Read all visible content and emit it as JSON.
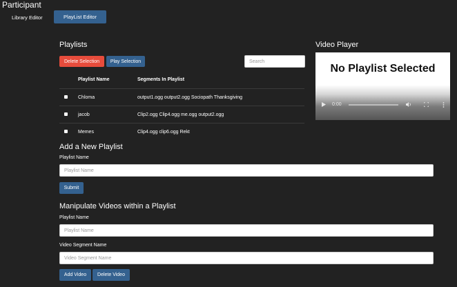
{
  "app": {
    "title": "Participant"
  },
  "nav": {
    "library_editor": "Library Editor",
    "playlist_editor": "PlayList Editor"
  },
  "playlists": {
    "title": "Playlists",
    "delete_selection": "Delete Selection",
    "play_selection": "Play Selection",
    "search_placeholder": "Search",
    "columns": [
      "Playlist Name",
      "Segments In Playlist"
    ],
    "rows": [
      {
        "name": "Chloma",
        "segments": "output1.ogg output2.ogg Sociopath Thanksgiving"
      },
      {
        "name": "jacob",
        "segments": "Clip2.ogg Clip4.ogg me.ogg output2.ogg"
      },
      {
        "name": "Memes",
        "segments": "Clip4.ogg clip6.ogg Rekt"
      }
    ]
  },
  "video_player": {
    "title": "Video Player",
    "message": "No Playlist Selected",
    "time": "0:00"
  },
  "add_playlist": {
    "title": "Add a New Playlist",
    "name_label": "Playlist Name",
    "name_placeholder": "Playlist Name",
    "submit": "Submit"
  },
  "manipulate": {
    "title": "Manipulate Videos within a Playlist",
    "name_label": "Playlist Name",
    "name_placeholder": "Playlist Name",
    "segment_label": "Video Segment Name",
    "segment_placeholder": "Video Segment Name",
    "add_video": "Add Video",
    "delete_video": "Delete Video"
  },
  "icons": {
    "play": "play-icon",
    "volume": "volume-icon",
    "fullscreen": "fullscreen-icon",
    "more": "more-icon"
  },
  "colors": {
    "background": "#222222",
    "primary": "#34618f",
    "danger": "#e74c3c"
  }
}
